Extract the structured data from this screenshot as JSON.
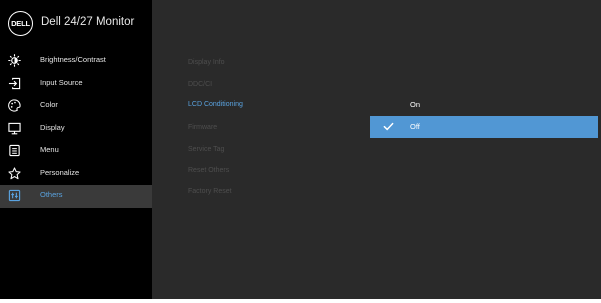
{
  "header": {
    "logo_text": "DELL",
    "title": "Dell 24/27 Monitor"
  },
  "sidebar": {
    "items": [
      {
        "label": "Brightness/Contrast",
        "icon": "brightness-icon"
      },
      {
        "label": "Input Source",
        "icon": "input-source-icon"
      },
      {
        "label": "Color",
        "icon": "color-icon"
      },
      {
        "label": "Display",
        "icon": "display-icon"
      },
      {
        "label": "Menu",
        "icon": "menu-icon"
      },
      {
        "label": "Personalize",
        "icon": "star-icon"
      },
      {
        "label": "Others",
        "icon": "others-icon",
        "active": true
      }
    ]
  },
  "submenu": {
    "items": [
      {
        "label": "Display Info"
      },
      {
        "label": "DDC/CI"
      },
      {
        "label": "LCD Conditioning",
        "highlighted": true
      },
      {
        "label": "Firmware"
      },
      {
        "label": "Service Tag"
      },
      {
        "label": "Reset Others"
      },
      {
        "label": "Factory Reset"
      }
    ]
  },
  "options": {
    "items": [
      {
        "label": "On",
        "selected": false
      },
      {
        "label": "Off",
        "selected": true
      }
    ]
  },
  "colors": {
    "sidebar_bg": "#000000",
    "panel_bg": "#2a2a2a",
    "accent": "#5197d4",
    "highlight_text": "#5aa3e0"
  }
}
